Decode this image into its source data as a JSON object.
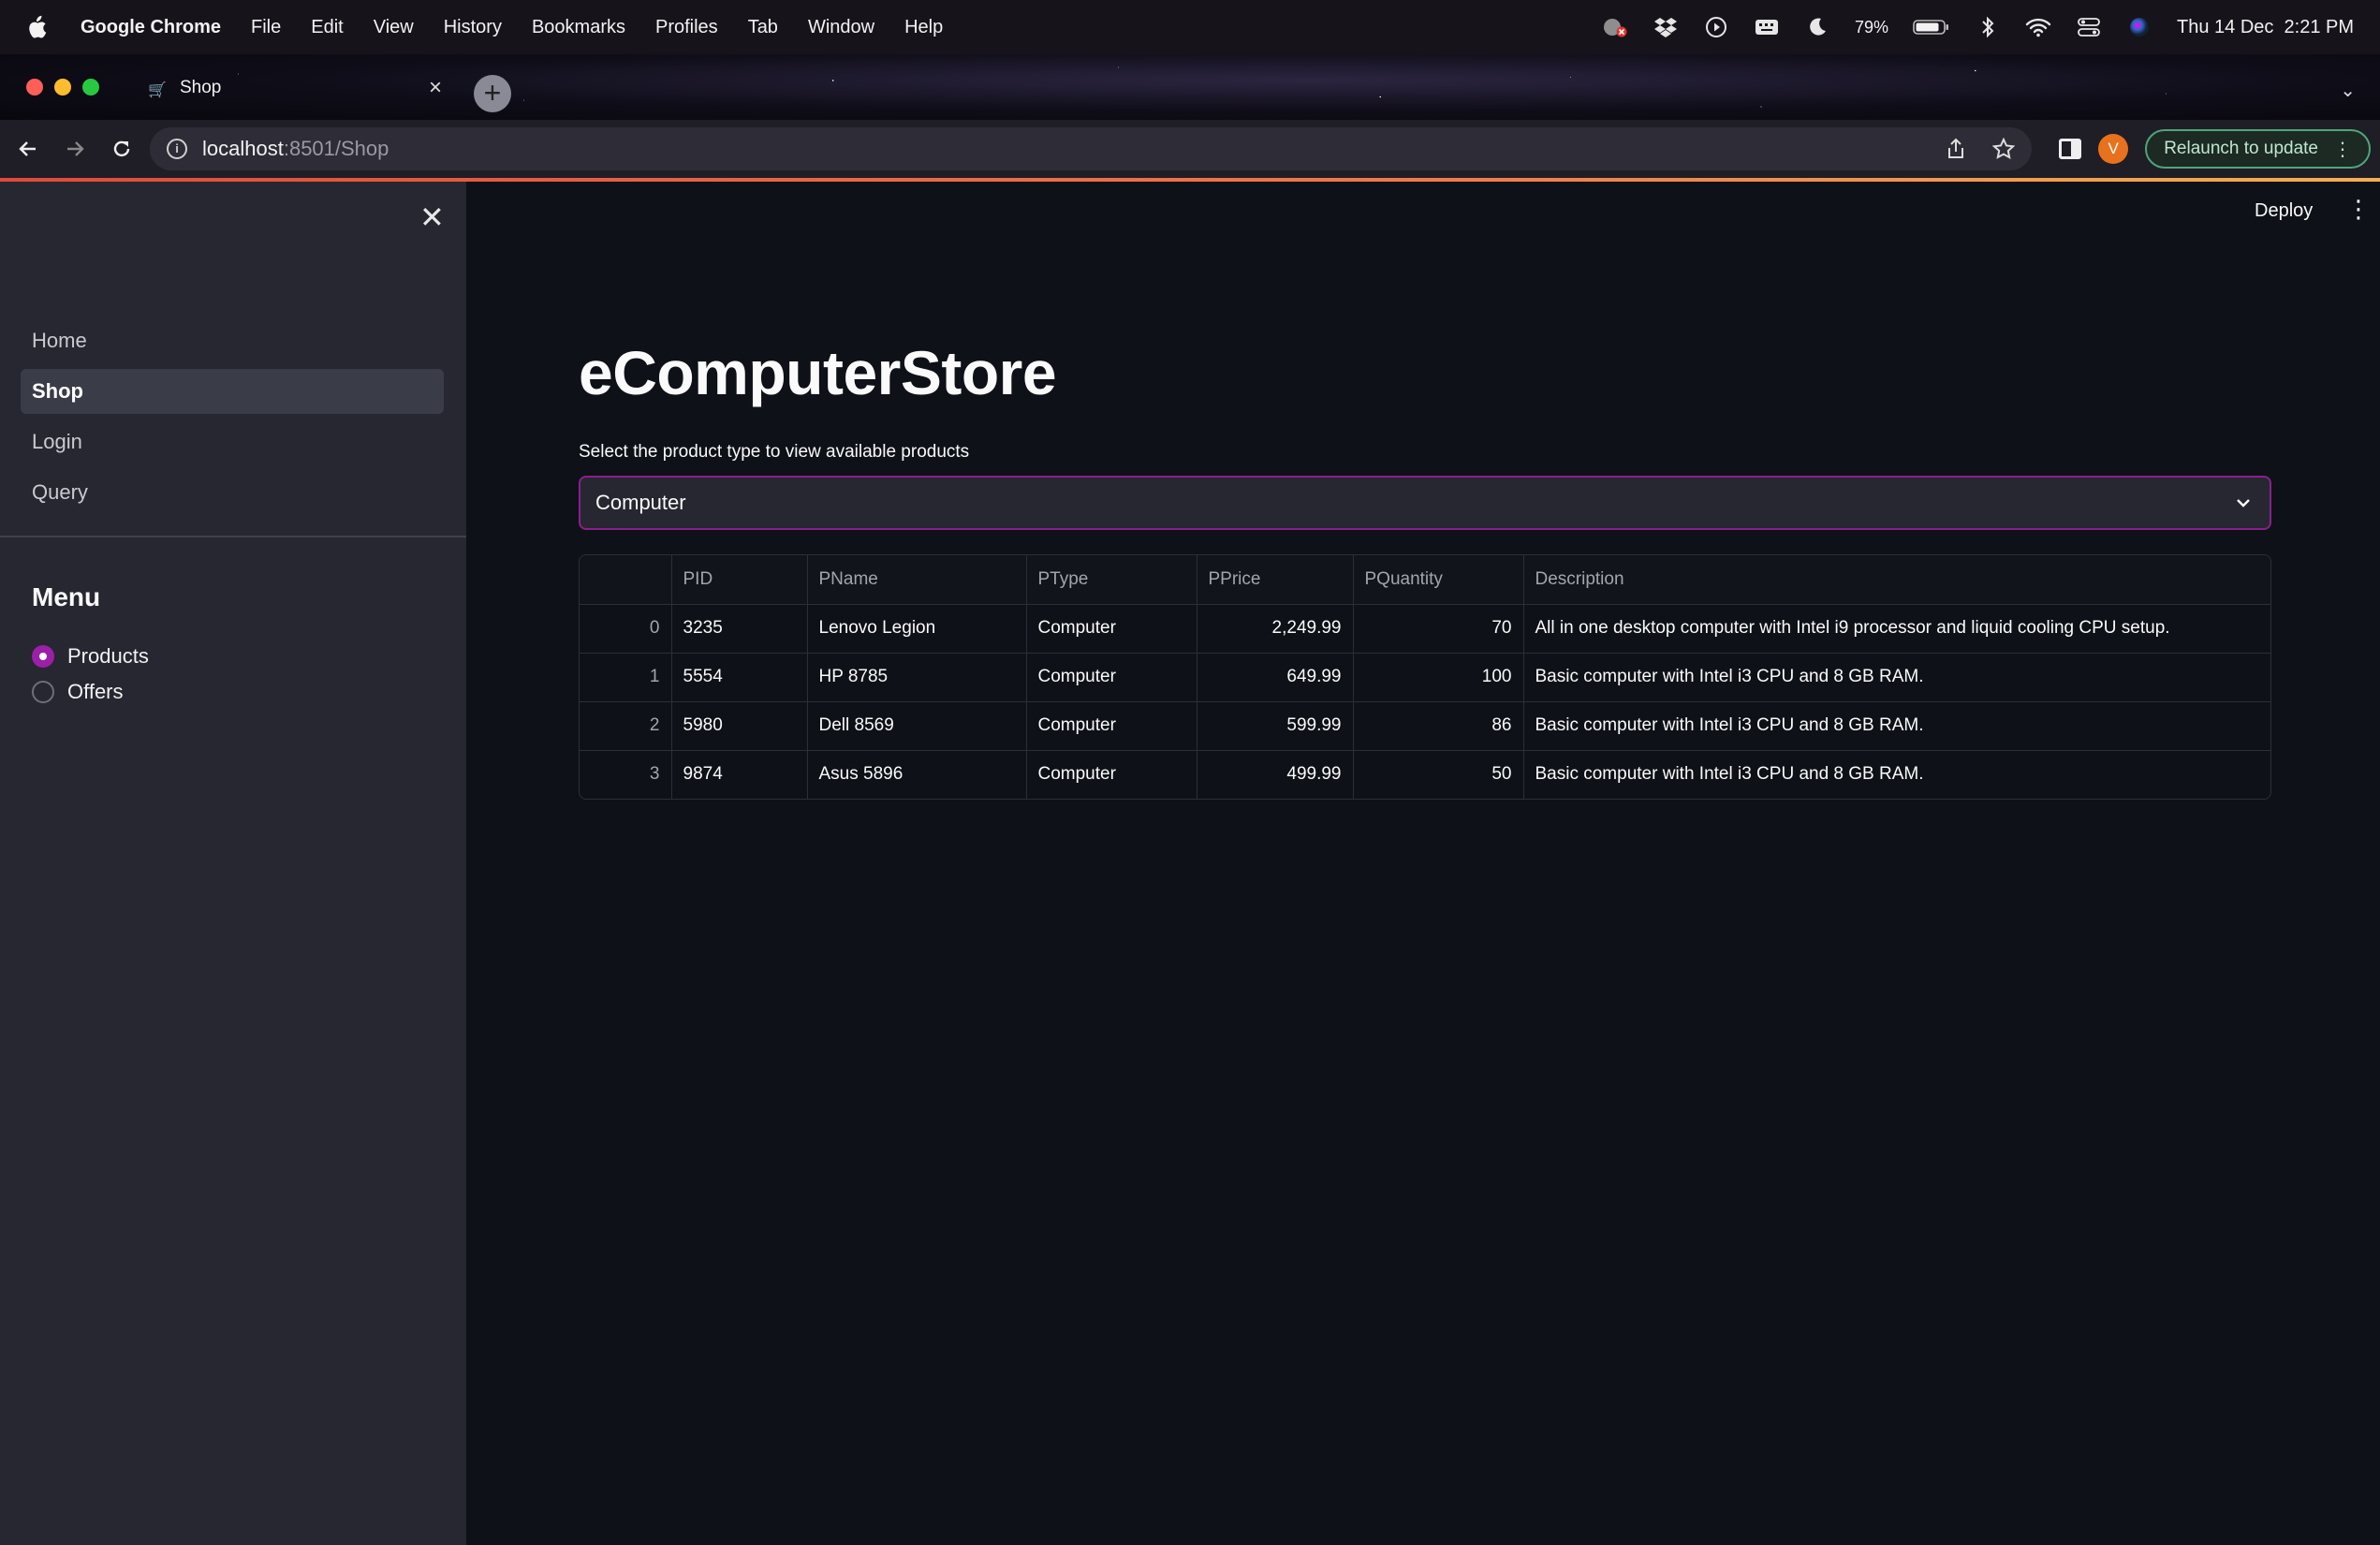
{
  "os": {
    "menu": [
      "Google Chrome",
      "File",
      "Edit",
      "View",
      "History",
      "Bookmarks",
      "Profiles",
      "Tab",
      "Window",
      "Help"
    ],
    "battery": "79%",
    "datetime": "Thu 14 Dec  2:21 PM"
  },
  "browser": {
    "tab_title": "Shop",
    "url_host": "localhost",
    "url_path": ":8501/Shop",
    "profile_initial": "V",
    "relaunch_label": "Relaunch to update"
  },
  "app": {
    "deploy_label": "Deploy",
    "sidebar": {
      "pages": [
        {
          "label": "Home",
          "active": false
        },
        {
          "label": "Shop",
          "active": true
        },
        {
          "label": "Login",
          "active": false
        },
        {
          "label": "Query",
          "active": false
        }
      ],
      "menu_title": "Menu",
      "options": [
        {
          "label": "Products",
          "selected": true
        },
        {
          "label": "Offers",
          "selected": false
        }
      ]
    },
    "title": "eComputerStore",
    "select_label": "Select the product type to view available products",
    "select_value": "Computer",
    "table": {
      "columns": [
        "",
        "PID",
        "PName",
        "PType",
        "PPrice",
        "PQuantity",
        "Description"
      ],
      "rows": [
        [
          "0",
          "3235",
          "Lenovo Legion",
          "Computer",
          "2,249.99",
          "70",
          "All in one desktop computer with Intel i9 processor and liquid cooling CPU setup."
        ],
        [
          "1",
          "5554",
          "HP 8785",
          "Computer",
          "649.99",
          "100",
          "Basic computer with Intel i3 CPU and 8 GB RAM."
        ],
        [
          "2",
          "5980",
          "Dell 8569",
          "Computer",
          "599.99",
          "86",
          "Basic computer with Intel i3 CPU and 8 GB RAM."
        ],
        [
          "3",
          "9874",
          "Asus 5896",
          "Computer",
          "499.99",
          "50",
          "Basic computer with Intel i3 CPU and 8 GB RAM."
        ]
      ]
    }
  }
}
